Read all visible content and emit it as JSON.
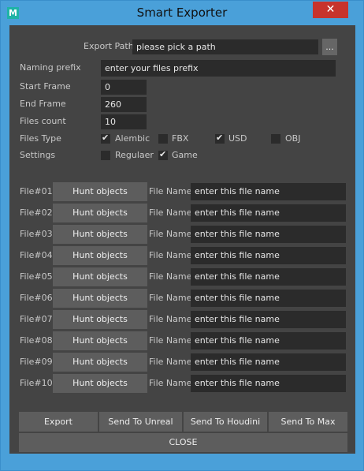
{
  "window": {
    "title": "Smart Exporter",
    "app_icon": "M",
    "close_glyph": "✕"
  },
  "export_path": {
    "label": "Export Path",
    "value": "please pick a path",
    "browse_label": "..."
  },
  "naming_prefix": {
    "label": "Naming prefix",
    "value": "enter your files prefix"
  },
  "start_frame": {
    "label": "Start Frame",
    "value": "0"
  },
  "end_frame": {
    "label": "End Frame",
    "value": "260"
  },
  "files_count": {
    "label": "Files count",
    "value": "10"
  },
  "files_type": {
    "label": "Files Type",
    "options": [
      {
        "label": "Alembic",
        "checked": true
      },
      {
        "label": "FBX",
        "checked": false
      },
      {
        "label": "USD",
        "checked": true
      },
      {
        "label": "OBJ",
        "checked": false
      }
    ]
  },
  "settings": {
    "label": "Settings",
    "options": [
      {
        "label": "Regulaer",
        "checked": false
      },
      {
        "label": "Game",
        "checked": true
      }
    ]
  },
  "files": [
    {
      "label": "File#01",
      "button": "Hunt objects",
      "name_label": "File Name",
      "name_value": "enter this file name"
    },
    {
      "label": "File#02",
      "button": "Hunt objects",
      "name_label": "File Name",
      "name_value": "enter this file name"
    },
    {
      "label": "File#03",
      "button": "Hunt objects",
      "name_label": "File Name",
      "name_value": "enter this file name"
    },
    {
      "label": "File#04",
      "button": "Hunt objects",
      "name_label": "File Name",
      "name_value": "enter this file name"
    },
    {
      "label": "File#05",
      "button": "Hunt objects",
      "name_label": "File Name",
      "name_value": "enter this file name"
    },
    {
      "label": "File#06",
      "button": "Hunt objects",
      "name_label": "File Name",
      "name_value": "enter this file name"
    },
    {
      "label": "File#07",
      "button": "Hunt objects",
      "name_label": "File Name",
      "name_value": "enter this file name"
    },
    {
      "label": "File#08",
      "button": "Hunt objects",
      "name_label": "File Name",
      "name_value": "enter this file name"
    },
    {
      "label": "File#09",
      "button": "Hunt objects",
      "name_label": "File Name",
      "name_value": "enter this file name"
    },
    {
      "label": "File#10",
      "button": "Hunt objects",
      "name_label": "File Name",
      "name_value": "enter this file name"
    }
  ],
  "actions": {
    "export": "Export",
    "send_unreal": "Send To Unreal",
    "send_houdini": "Send To Houdini",
    "send_max": "Send To Max",
    "close": "CLOSE"
  },
  "colors": {
    "window_border": "#4aa0d9",
    "panel_bg": "#444444",
    "field_bg": "#2b2b2b",
    "button_bg": "#5d5d5d",
    "close_red": "#c7332c",
    "app_icon": "#1fb3a6"
  }
}
